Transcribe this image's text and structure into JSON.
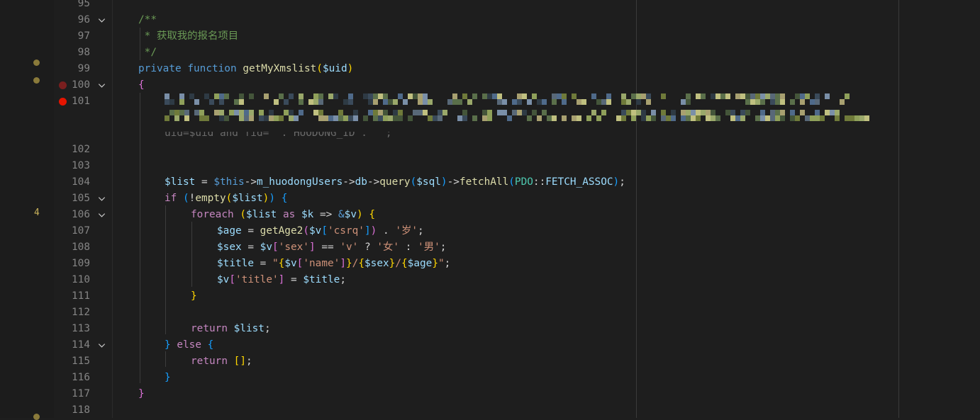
{
  "editor": {
    "lines": [
      {
        "num": "95",
        "text": ""
      },
      {
        "num": "96",
        "text": "/**"
      },
      {
        "num": "97",
        "text": " * 获取我的报名项目"
      },
      {
        "num": "98",
        "text": " */"
      },
      {
        "num": "99",
        "text": "private function getMyXmslist($uid)"
      },
      {
        "num": "100",
        "text": "{"
      },
      {
        "num": "101",
        "text": "[pixelated / redacted SQL string]"
      },
      {
        "num": "102",
        "text": ""
      },
      {
        "num": "103",
        "text": ""
      },
      {
        "num": "104",
        "text": "$list = $this->m_huodongUsers->db->query($sql)->fetchAll(PDO::FETCH_ASSOC);"
      },
      {
        "num": "105",
        "text": "if (!empty($list)) {"
      },
      {
        "num": "106",
        "text": "foreach ($list as $k => &$v) {"
      },
      {
        "num": "107",
        "text": "$age = getAge2($v['csrq']) . '岁';"
      },
      {
        "num": "108",
        "text": "$sex = $v['sex'] == 'v' ? '女' : '男';"
      },
      {
        "num": "109",
        "text": "$title = \"{$v['name']}/{$sex}/{$age}\";"
      },
      {
        "num": "110",
        "text": "$v['title'] = $title;"
      },
      {
        "num": "111",
        "text": "}"
      },
      {
        "num": "112",
        "text": ""
      },
      {
        "num": "113",
        "text": "return $list;"
      },
      {
        "num": "114",
        "text": "} else {"
      },
      {
        "num": "115",
        "text": "return [];"
      },
      {
        "num": "116",
        "text": "}"
      },
      {
        "num": "117",
        "text": "}"
      },
      {
        "num": "118",
        "text": ""
      }
    ],
    "annotation_106": "4",
    "redacted_line_tail": "uid=$uid and fid=\" . HUODONG_ID . \"\";",
    "colors": {
      "background": "#1e1e1e",
      "breakpoint": "#e51400",
      "breakpoint_dim": "#8a1c1c",
      "marker": "#a08a3c"
    }
  }
}
